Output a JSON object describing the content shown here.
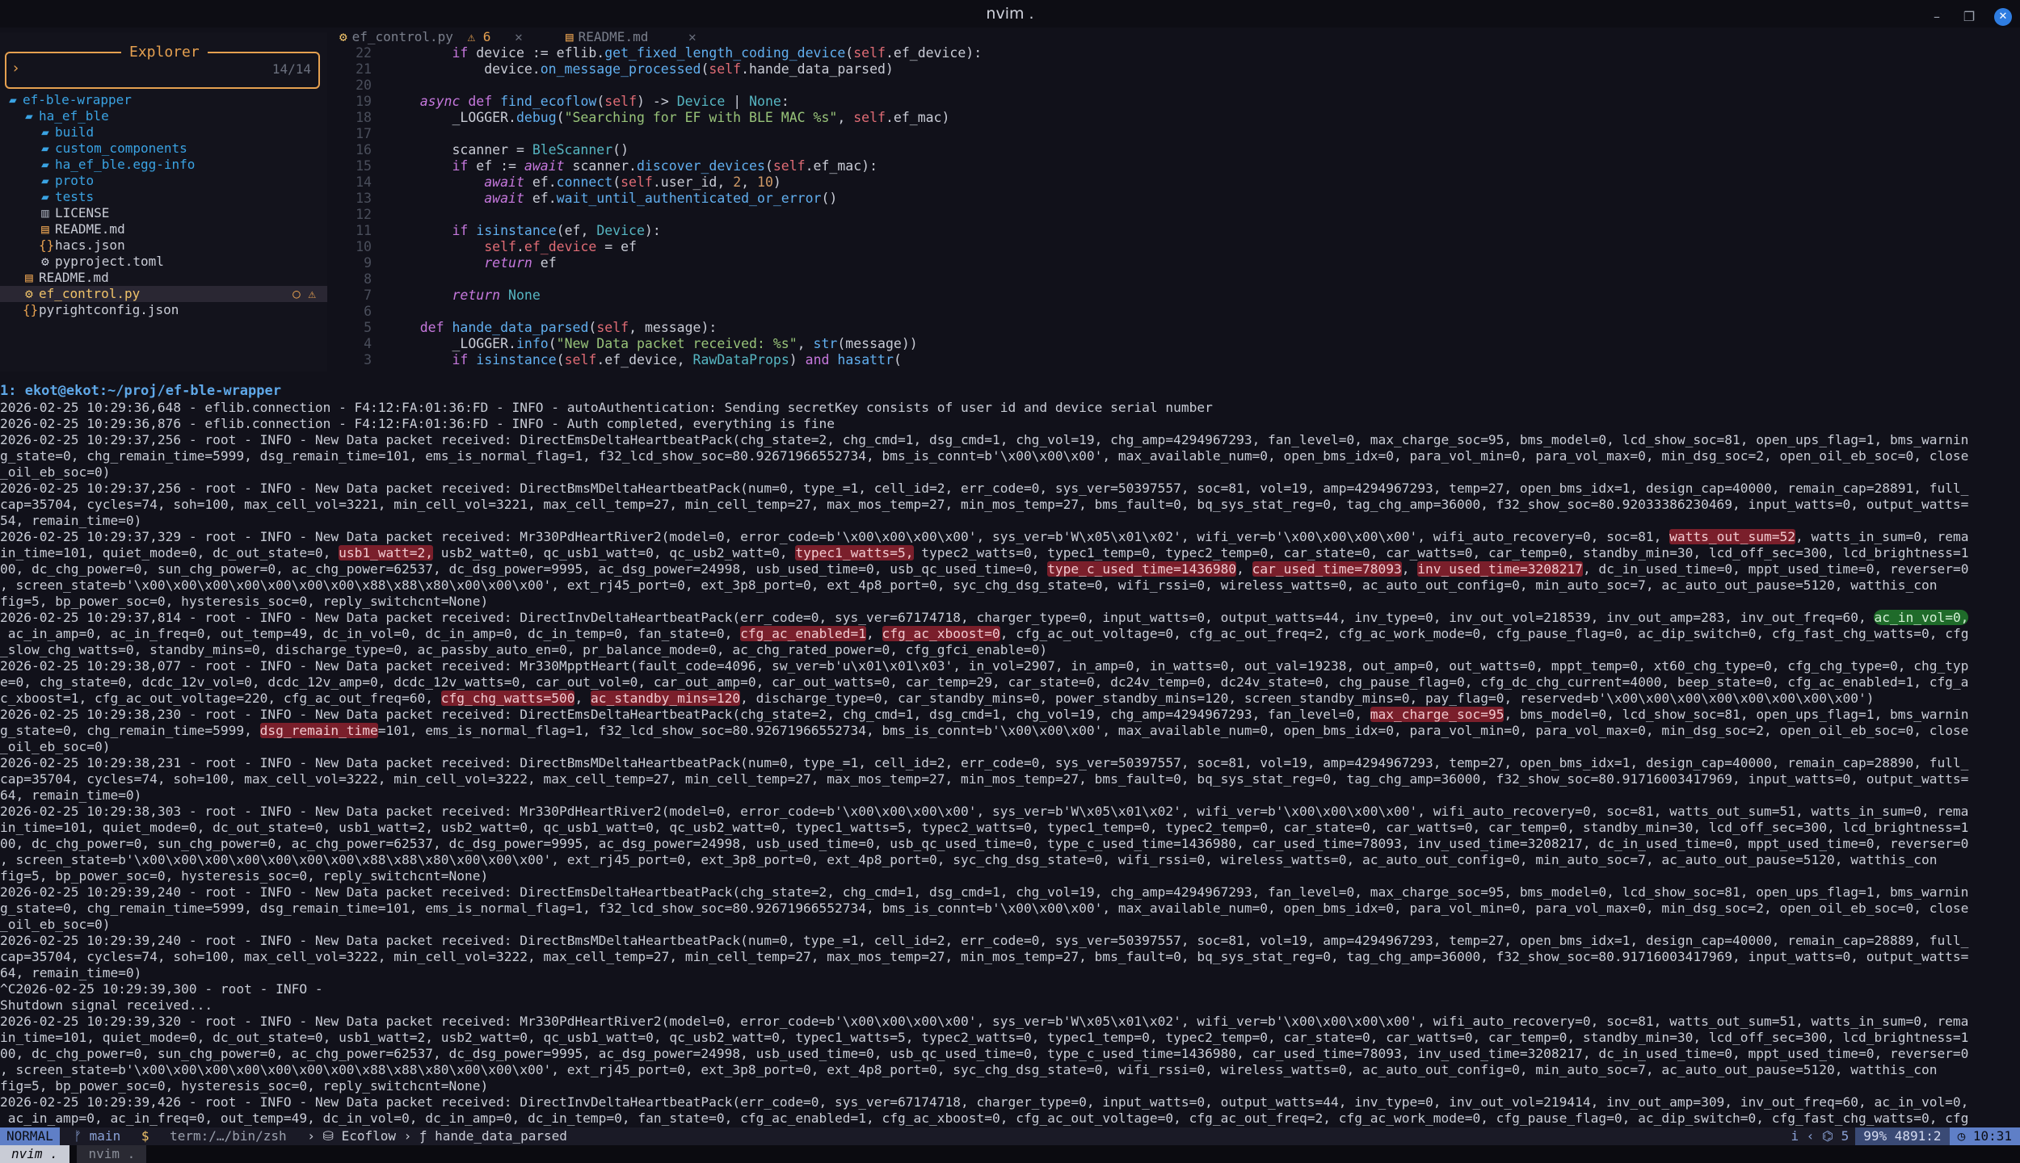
{
  "window": {
    "title": "nvim .",
    "controls": [
      "–",
      "❐",
      "✕"
    ]
  },
  "explorer": {
    "title": "Explorer",
    "prompt": "›",
    "count": "14/14",
    "items": [
      {
        "label": "ef-ble-wrapper",
        "indent": 0,
        "type": "folder"
      },
      {
        "label": "ha_ef_ble",
        "indent": 1,
        "type": "folder"
      },
      {
        "label": "build",
        "indent": 2,
        "type": "folder"
      },
      {
        "label": "custom_components",
        "indent": 2,
        "type": "folder"
      },
      {
        "label": "ha_ef_ble.egg-info",
        "indent": 2,
        "type": "folder"
      },
      {
        "label": "proto",
        "indent": 2,
        "type": "folder"
      },
      {
        "label": "tests",
        "indent": 2,
        "type": "folder"
      },
      {
        "label": "LICENSE",
        "indent": 2,
        "type": "file"
      },
      {
        "label": "README.md",
        "indent": 2,
        "type": "md"
      },
      {
        "label": "hacs.json",
        "indent": 2,
        "type": "json"
      },
      {
        "label": "pyproject.toml",
        "indent": 2,
        "type": "toml"
      },
      {
        "label": "README.md",
        "indent": 1,
        "type": "md"
      },
      {
        "label": "ef_control.py",
        "indent": 1,
        "type": "py",
        "selected": true
      },
      {
        "label": "pyrightconfig.json",
        "indent": 1,
        "type": "json"
      }
    ]
  },
  "tabs": [
    {
      "label": "ef_control.py",
      "badge": "⚠ 6",
      "close": "✕"
    },
    {
      "label": "README.md",
      "badge": "",
      "close": "✕"
    }
  ],
  "code_lines": [
    {
      "n": "22",
      "html": "        <span class=\"kw2\">if</span> device := eflib.<span class=\"fn\">get_fixed_length_coding_device</span>(<span class=\"self\">self</span>.ef_device):"
    },
    {
      "n": "21",
      "html": "            device.<span class=\"fn\">on_message_processed</span>(<span class=\"self\">self</span>.hande_data_parsed)"
    },
    {
      "n": "20",
      "html": ""
    },
    {
      "n": "19",
      "html": "    <span class=\"kw\">async</span> <span class=\"kw2\">def</span> <span class=\"fn\">find_ecoflow</span>(<span class=\"self\">self</span>) -&gt; <span class=\"cls\">Device</span> | <span class=\"cls\">None</span>:"
    },
    {
      "n": "18",
      "html": "        _LOGGER.<span class=\"fn\">debug</span>(<span class=\"str\">\"Searching for EF with BLE MAC %s\"</span>, <span class=\"self\">self</span>.ef_mac)"
    },
    {
      "n": "17",
      "html": ""
    },
    {
      "n": "16",
      "html": "        scanner = <span class=\"cls\">BleScanner</span>()"
    },
    {
      "n": "15",
      "html": "        <span class=\"kw2\">if</span> ef := <span class=\"kw\">await</span> scanner.<span class=\"fn\">discover_devices</span>(<span class=\"self\">self</span>.ef_mac):"
    },
    {
      "n": "14",
      "html": "            <span class=\"kw\">await</span> ef.<span class=\"fn\">connect</span>(<span class=\"self\">self</span>.user_id, <span class=\"num\">2</span>, <span class=\"num\">10</span>)"
    },
    {
      "n": "13",
      "html": "            <span class=\"kw\">await</span> ef.<span class=\"fn\">wait_until_authenticated_or_error</span>()"
    },
    {
      "n": "12",
      "html": ""
    },
    {
      "n": "11",
      "html": "        <span class=\"kw2\">if</span> <span class=\"fn\">isinstance</span>(ef, <span class=\"cls\">Device</span>):"
    },
    {
      "n": "10",
      "html": "            <span class=\"self\">self</span>.<span class=\"self\">ef_device</span> = ef"
    },
    {
      "n": "9",
      "html": "            <span class=\"kw\">return</span> ef"
    },
    {
      "n": "8",
      "html": ""
    },
    {
      "n": "7",
      "html": "        <span class=\"kw\">return</span> <span class=\"cls\">None</span>"
    },
    {
      "n": "6",
      "html": ""
    },
    {
      "n": "5",
      "html": "    <span class=\"kw2\">def</span> <span class=\"fn\">hande_data_parsed</span>(<span class=\"self\">self</span>, message):"
    },
    {
      "n": "4",
      "html": "        _LOGGER.<span class=\"fn\">info</span>(<span class=\"str\">\"New Data packet received: %s\"</span>, <span class=\"fn\">str</span>(message))"
    },
    {
      "n": "3",
      "html": "        <span class=\"kw2\">if</span> <span class=\"fn\">isinstance</span>(<span class=\"self\">self</span>.ef_device, <span class=\"cls\">RawDataProps</span>) <span class=\"kw2\">and</span> <span class=\"fn\">hasattr</span>("
    }
  ],
  "terminal": {
    "header": "1: ekot@ekot:~/proj/ef-ble-wrapper",
    "lines": [
      "2026-02-25 10:29:36,648 - eflib.connection - F4:12:FA:01:36:FD - INFO - autoAuthentication: Sending secretKey consists of user id and device serial number",
      "2026-02-25 10:29:36,876 - eflib.connection - F4:12:FA:01:36:FD - INFO - Auth completed, everything is fine",
      "2026-02-25 10:29:37,256 - root - INFO - New Data packet received: DirectEmsDeltaHeartbeatPack(chg_state=2, chg_cmd=1, dsg_cmd=1, chg_vol=19, chg_amp=4294967293, fan_level=0, max_charge_soc=95, bms_model=0, lcd_show_soc=81, open_ups_flag=1, bms_warnin",
      "g_state=0, chg_remain_time=5999, dsg_remain_time=101, ems_is_normal_flag=1, f32_lcd_show_soc=80.92671966552734, bms_is_connt=b'\\x00\\x00\\x00', max_available_num=0, open_bms_idx=0, para_vol_min=0, para_vol_max=0, min_dsg_soc=2, open_oil_eb_soc=0, close",
      "_oil_eb_soc=0)",
      "2026-02-25 10:29:37,256 - root - INFO - New Data packet received: DirectBmsMDeltaHeartbeatPack(num=0, type_=1, cell_id=2, err_code=0, sys_ver=50397557, soc=81, vol=19, amp=4294967293, temp=27, open_bms_idx=1, design_cap=40000, remain_cap=28891, full_",
      "cap=35704, cycles=74, soh=100, max_cell_vol=3221, min_cell_vol=3221, max_cell_temp=27, min_cell_temp=27, max_mos_temp=27, min_mos_temp=27, bms_fault=0, bq_sys_stat_reg=0, tag_chg_amp=36000, f32_show_soc=80.92033386230469, input_watts=0, output_watts=",
      "54, remain_time=0)",
      "2026-02-25 10:29:37,329 - root - INFO - New Data packet received: Mr330PdHeartRiver2(model=0, error_code=b'\\x00\\x00\\x00\\x00', sys_ver=b'W\\x05\\x01\\x02', wifi_ver=b'\\x00\\x00\\x00\\x00', wifi_auto_recovery=0, soc=81, watts_out_sum=52, watts_in_sum=0, rema",
      "in_time=101, quiet_mode=0, dc_out_state=0, usb1_watt=2, usb2_watt=0, qc_usb1_watt=0, qc_usb2_watt=0, typec1_watts=5, typec2_watts=0, typec1_temp=0, typec2_temp=0, car_state=0, car_watts=0, car_temp=0, standby_min=30, lcd_off_sec=300, lcd_brightness=1",
      "00, dc_chg_power=0, sun_chg_power=0, ac_chg_power=62537, dc_dsg_power=9995, ac_dsg_power=24998, usb_used_time=0, usb_qc_used_time=0, type_c_used_time=1436980, car_used_time=78093, inv_used_time=3208217, dc_in_used_time=0, mppt_used_time=0, reverser=0",
      ", screen_state=b'\\x00\\x00\\x00\\x00\\x00\\x00\\x00\\x88\\x88\\x80\\x00\\x00\\x00', ext_rj45_port=0, ext_3p8_port=0, ext_4p8_port=0, syc_chg_dsg_state=0, wifi_rssi=0, wireless_watts=0, ac_auto_out_config=0, min_auto_soc=7, ac_auto_out_pause=5120, watthis_con",
      "fig=5, bp_power_soc=0, hysteresis_soc=0, reply_switchcnt=None)",
      "2026-02-25 10:29:37,814 - root - INFO - New Data packet received: DirectInvDeltaHeartbeatPack(err_code=0, sys_ver=67174718, charger_type=0, input_watts=0, output_watts=44, inv_type=0, inv_out_vol=218539, inv_out_amp=283, inv_out_freq=60, ac_in_vol=0,",
      " ac_in_amp=0, ac_in_freq=0, out_temp=49, dc_in_vol=0, dc_in_amp=0, dc_in_temp=0, fan_state=0, cfg_ac_enabled=1, cfg_ac_xboost=0, cfg_ac_out_voltage=0, cfg_ac_out_freq=2, cfg_ac_work_mode=0, cfg_pause_flag=0, ac_dip_switch=0, cfg_fast_chg_watts=0, cfg",
      "_slow_chg_watts=0, standby_mins=0, discharge_type=0, ac_passby_auto_en=0, pr_balance_mode=0, ac_chg_rated_power=0, cfg_gfci_enable=0)",
      "2026-02-25 10:29:38,077 - root - INFO - New Data packet received: Mr330MpptHeart(fault_code=4096, sw_ver=b'u\\x01\\x01\\x03', in_vol=2907, in_amp=0, in_watts=0, out_val=19238, out_amp=0, out_watts=0, mppt_temp=0, xt60_chg_type=0, cfg_chg_type=0, chg_typ",
      "e=0, chg_state=0, dcdc_12v_vol=0, dcdc_12v_amp=0, dcdc_12v_watts=0, car_out_vol=0, car_out_amp=0, car_out_watts=0, car_temp=29, car_state=0, dc24v_temp=0, dc24v_state=0, chg_pause_flag=0, cfg_dc_chg_current=4000, beep_state=0, cfg_ac_enabled=1, cfg_a",
      "c_xboost=1, cfg_ac_out_voltage=220, cfg_ac_out_freq=60, cfg_chg_watts=500, ac_standby_mins=120, discharge_type=0, car_standby_mins=0, power_standby_mins=120, screen_standby_mins=0, pay_flag=0, reserved=b'\\x00\\x00\\x00\\x00\\x00\\x00\\x00\\x00')",
      "2026-02-25 10:29:38,230 - root - INFO - New Data packet received: DirectEmsDeltaHeartbeatPack(chg_state=2, chg_cmd=1, dsg_cmd=1, chg_vol=19, chg_amp=4294967293, fan_level=0, max_charge_soc=95, bms_model=0, lcd_show_soc=81, open_ups_flag=1, bms_warnin",
      "g_state=0, chg_remain_time=5999, dsg_remain_time=101, ems_is_normal_flag=1, f32_lcd_show_soc=80.92671966552734, bms_is_connt=b'\\x00\\x00\\x00', max_available_num=0, open_bms_idx=0, para_vol_min=0, para_vol_max=0, min_dsg_soc=2, open_oil_eb_soc=0, close",
      "_oil_eb_soc=0)",
      "2026-02-25 10:29:38,231 - root - INFO - New Data packet received: DirectBmsMDeltaHeartbeatPack(num=0, type_=1, cell_id=2, err_code=0, sys_ver=50397557, soc=81, vol=19, amp=4294967293, temp=27, open_bms_idx=1, design_cap=40000, remain_cap=28890, full_",
      "cap=35704, cycles=74, soh=100, max_cell_vol=3222, min_cell_vol=3222, max_cell_temp=27, min_cell_temp=27, max_mos_temp=27, min_mos_temp=27, bms_fault=0, bq_sys_stat_reg=0, tag_chg_amp=36000, f32_show_soc=80.91716003417969, input_watts=0, output_watts=",
      "64, remain_time=0)",
      "2026-02-25 10:29:38,303 - root - INFO - New Data packet received: Mr330PdHeartRiver2(model=0, error_code=b'\\x00\\x00\\x00\\x00', sys_ver=b'W\\x05\\x01\\x02', wifi_ver=b'\\x00\\x00\\x00\\x00', wifi_auto_recovery=0, soc=81, watts_out_sum=51, watts_in_sum=0, rema",
      "in_time=101, quiet_mode=0, dc_out_state=0, usb1_watt=2, usb2_watt=0, qc_usb1_watt=0, qc_usb2_watt=0, typec1_watts=5, typec2_watts=0, typec1_temp=0, typec2_temp=0, car_state=0, car_watts=0, car_temp=0, standby_min=30, lcd_off_sec=300, lcd_brightness=1",
      "00, dc_chg_power=0, sun_chg_power=0, ac_chg_power=62537, dc_dsg_power=9995, ac_dsg_power=24998, usb_used_time=0, usb_qc_used_time=0, type_c_used_time=1436980, car_used_time=78093, inv_used_time=3208217, dc_in_used_time=0, mppt_used_time=0, reverser=0",
      ", screen_state=b'\\x00\\x00\\x00\\x00\\x00\\x00\\x00\\x88\\x88\\x80\\x00\\x00\\x00', ext_rj45_port=0, ext_3p8_port=0, ext_4p8_port=0, syc_chg_dsg_state=0, wifi_rssi=0, wireless_watts=0, ac_auto_out_config=0, min_auto_soc=7, ac_auto_out_pause=5120, watthis_con",
      "fig=5, bp_power_soc=0, hysteresis_soc=0, reply_switchcnt=None)",
      "2026-02-25 10:29:39,240 - root - INFO - New Data packet received: DirectEmsDeltaHeartbeatPack(chg_state=2, chg_cmd=1, dsg_cmd=1, chg_vol=19, chg_amp=4294967293, fan_level=0, max_charge_soc=95, bms_model=0, lcd_show_soc=81, open_ups_flag=1, bms_warnin",
      "g_state=0, chg_remain_time=5999, dsg_remain_time=101, ems_is_normal_flag=1, f32_lcd_show_soc=80.92671966552734, bms_is_connt=b'\\x00\\x00\\x00', max_available_num=0, open_bms_idx=0, para_vol_min=0, para_vol_max=0, min_dsg_soc=2, open_oil_eb_soc=0, close",
      "_oil_eb_soc=0)",
      "2026-02-25 10:29:39,240 - root - INFO - New Data packet received: DirectBmsMDeltaHeartbeatPack(num=0, type_=1, cell_id=2, err_code=0, sys_ver=50397557, soc=81, vol=19, amp=4294967293, temp=27, open_bms_idx=1, design_cap=40000, remain_cap=28889, full_",
      "cap=35704, cycles=74, soh=100, max_cell_vol=3222, min_cell_vol=3222, max_cell_temp=27, min_cell_temp=27, max_mos_temp=27, min_mos_temp=27, bms_fault=0, bq_sys_stat_reg=0, tag_chg_amp=36000, f32_show_soc=80.91716003417969, input_watts=0, output_watts=",
      "64, remain_time=0)",
      "^C2026-02-25 10:29:39,300 - root - INFO -",
      "Shutdown signal received...",
      "2026-02-25 10:29:39,320 - root - INFO - New Data packet received: Mr330PdHeartRiver2(model=0, error_code=b'\\x00\\x00\\x00\\x00', sys_ver=b'W\\x05\\x01\\x02', wifi_ver=b'\\x00\\x00\\x00\\x00', wifi_auto_recovery=0, soc=81, watts_out_sum=51, watts_in_sum=0, rema",
      "in_time=101, quiet_mode=0, dc_out_state=0, usb1_watt=2, usb2_watt=0, qc_usb1_watt=0, qc_usb2_watt=0, typec1_watts=5, typec2_watts=0, typec1_temp=0, typec2_temp=0, car_state=0, car_watts=0, car_temp=0, standby_min=30, lcd_off_sec=300, lcd_brightness=1",
      "00, dc_chg_power=0, sun_chg_power=0, ac_chg_power=62537, dc_dsg_power=9995, ac_dsg_power=24998, usb_used_time=0, usb_qc_used_time=0, type_c_used_time=1436980, car_used_time=78093, inv_used_time=3208217, dc_in_used_time=0, mppt_used_time=0, reverser=0",
      ", screen_state=b'\\x00\\x00\\x00\\x00\\x00\\x00\\x00\\x88\\x88\\x80\\x00\\x00\\x00', ext_rj45_port=0, ext_3p8_port=0, ext_4p8_port=0, syc_chg_dsg_state=0, wifi_rssi=0, wireless_watts=0, ac_auto_out_config=0, min_auto_soc=7, ac_auto_out_pause=5120, watthis_con",
      "fig=5, bp_power_soc=0, hysteresis_soc=0, reply_switchcnt=None)",
      "2026-02-25 10:29:39,426 - root - INFO - New Data packet received: DirectInvDeltaHeartbeatPack(err_code=0, sys_ver=67174718, charger_type=0, input_watts=0, output_watts=44, inv_type=0, inv_out_vol=219414, inv_out_amp=309, inv_out_freq=60, ac_in_vol=0,",
      " ac_in_amp=0, ac_in_freq=0, out_temp=49, dc_in_vol=0, dc_in_amp=0, dc_in_temp=0, fan_state=0, cfg_ac_enabled=1, cfg_ac_xboost=0, cfg_ac_out_voltage=0, cfg_ac_out_freq=2, cfg_ac_work_mode=0, cfg_pause_flag=0, ac_dip_switch=0, cfg_fast_chg_watts=0, cfg"
    ],
    "highlights": [
      {
        "line": 8,
        "text": "watts_out_sum=52",
        "kind": "red"
      },
      {
        "line": 9,
        "text": "usb1_watt=2,",
        "kind": "red"
      },
      {
        "line": 9,
        "text": "typec1_watts=5,",
        "kind": "red"
      },
      {
        "line": 10,
        "text": "type_c_used_time=1436980",
        "kind": "red"
      },
      {
        "line": 10,
        "text": "car_used_time=78093",
        "kind": "red"
      },
      {
        "line": 10,
        "text": "inv_used_time=3208217",
        "kind": "red"
      },
      {
        "line": 13,
        "text": "ac_in_vol=0,",
        "kind": "green"
      },
      {
        "line": 14,
        "text": "cfg_ac_enabled=1",
        "kind": "red"
      },
      {
        "line": 14,
        "text": "cfg_ac_xboost=0",
        "kind": "red"
      },
      {
        "line": 18,
        "text": "cfg_chg_watts=500",
        "kind": "red"
      },
      {
        "line": 18,
        "text": "ac_standby_mins=120",
        "kind": "red"
      },
      {
        "line": 19,
        "text": "max_charge_soc=95",
        "kind": "red"
      },
      {
        "line": 20,
        "text": "dsg_remain_time",
        "kind": "red"
      },
      {
        "line": 33,
        "text": "cycles=74,",
        "kind": "red"
      }
    ]
  },
  "statusline": {
    "mode": "NORMAL",
    "branch": "ᚠ main",
    "dollar": "$",
    "term": "term:/…/bin/zsh",
    "breadcrumb": "› ⛁ Ecoflow › ƒ hande_data_parsed",
    "right_info": "i  ‹  ⌬ 5",
    "percent": "99% 4891:2",
    "time": "◷ 10:31"
  },
  "tmux": {
    "active": "nvim .",
    "inactive": "nvim ."
  },
  "colors": {
    "accent": "#e5a050",
    "folder": "#3aa3e3",
    "highlight_red": "#7a1f2b",
    "highlight_green": "#1f6b2a",
    "mode": "#5f7fc7"
  }
}
